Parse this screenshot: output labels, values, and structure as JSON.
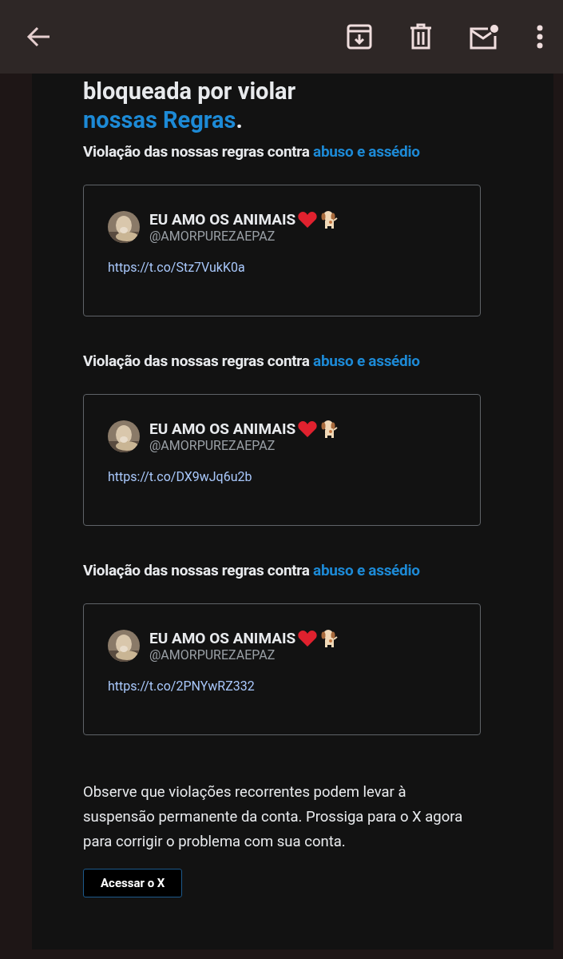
{
  "toolbar": {
    "actions": [
      {
        "kind": "archive"
      },
      {
        "kind": "delete"
      },
      {
        "kind": "unread"
      },
      {
        "kind": "more"
      }
    ]
  },
  "heading": {
    "text": "bloqueada por violar ",
    "link": "nossas Regras",
    "end": "."
  },
  "violations": [
    {
      "label": "Violação das nossas regras contra ",
      "link": "abuso e assédio",
      "post": {
        "name": "EU AMO OS ANIMAIS",
        "handle": "@AMORPUREZAEPAZ",
        "url": "https://t.co/Stz7VukK0a"
      }
    },
    {
      "label": "Violação das nossas regras contra ",
      "link": "abuso e assédio",
      "post": {
        "name": "EU AMO OS ANIMAIS",
        "handle": "@AMORPUREZAEPAZ",
        "url": "https://t.co/DX9wJq6u2b"
      }
    },
    {
      "label": "Violação das nossas regras contra ",
      "link": "abuso e assédio",
      "post": {
        "name": "EU AMO OS ANIMAIS",
        "handle": "@AMORPUREZAEPAZ",
        "url": "https://t.co/2PNYwRZ332"
      }
    }
  ],
  "notice": "Observe que violações recorrentes podem levar à suspensão permanente da conta. Prossiga para o X agora para corrigir o problema com sua conta.",
  "button": "Acessar o X"
}
